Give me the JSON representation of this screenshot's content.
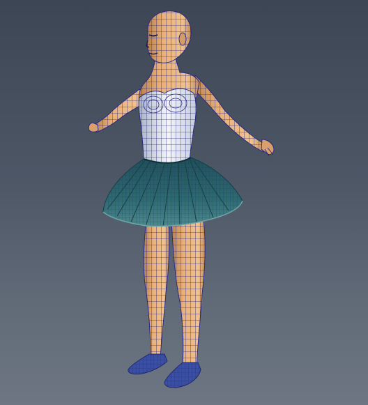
{
  "viewport": {
    "background_top": "#3d4654",
    "background_bottom": "#6d7682"
  },
  "model": {
    "name": "ballerina-character",
    "pose": "T-pose",
    "display_mode": "wireframe-on-shaded",
    "colors": {
      "skin": "#e9b07a",
      "skin_shadow": "#b5804d",
      "leotard": "#e9edf5",
      "leotard_shadow": "#a9b2c6",
      "tutu": "#2d6a6f",
      "tutu_light": "#4d8a8c",
      "tutu_dark": "#163f46",
      "shoes": "#2f3f8f",
      "wire": "#2a2a86"
    }
  }
}
